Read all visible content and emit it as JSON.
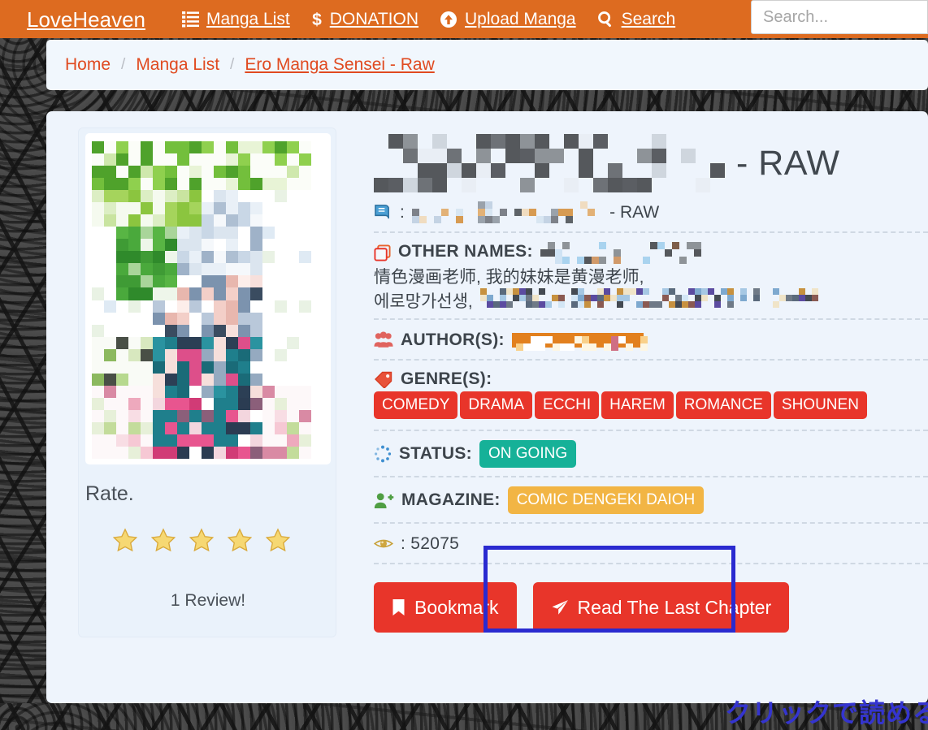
{
  "navbar": {
    "brand": "LoveHeaven",
    "accent_color": "#dd6b20",
    "links": [
      {
        "label": "Manga List",
        "icon": "list-icon"
      },
      {
        "label": "DONATION",
        "icon": "dollar-icon"
      },
      {
        "label": "Upload Manga",
        "icon": "upload-circle-icon"
      },
      {
        "label": "Search",
        "icon": "search-icon"
      }
    ],
    "search": {
      "placeholder": "Search...",
      "value": ""
    }
  },
  "breadcrumb": {
    "items": [
      {
        "label": "Home",
        "link": true
      },
      {
        "label": "Manga List",
        "link": true
      },
      {
        "label": "Ero Manga Sensei - Raw",
        "link": true
      }
    ],
    "separator": "/",
    "link_color": "#e04a20"
  },
  "manga": {
    "title_censored": true,
    "title_suffix": "- RAW",
    "cover_censored": true,
    "rate": {
      "label": "Rate.",
      "stars_total": 5,
      "stars_filled": 5,
      "review_text": "1 Review!"
    },
    "meta": {
      "alt_title": {
        "icon": "book-icon",
        "label": ":",
        "censored": true,
        "suffix": "- RAW"
      },
      "other_names": {
        "icon": "copy-icon",
        "label": "OTHER NAMES:",
        "visible_values": [
          "情色漫画老师, 我的妹妹是黄漫老师,",
          "에로망가선생,"
        ],
        "censored": true
      },
      "authors": {
        "icon": "users-icon",
        "label": "AUTHOR(S):",
        "censored": true
      },
      "genres": {
        "icon": "tag-icon",
        "label": "GENRE(S):",
        "values": [
          "COMEDY",
          "DRAMA",
          "ECCHI",
          "HAREM",
          "ROMANCE",
          "SHOUNEN"
        ],
        "badge_color": "#e8352a"
      },
      "status": {
        "icon": "spinner-icon",
        "label": "STATUS:",
        "value": "ON GOING",
        "badge_color": "#16b198"
      },
      "magazine": {
        "icon": "user-plus-icon",
        "label": "MAGAZINE:",
        "value": "COMIC DENGEKI DAIOH",
        "badge_color": "#f2b544"
      },
      "views": {
        "icon": "eye-icon",
        "label": ": 52075"
      }
    },
    "buttons": {
      "bookmark": {
        "label": "Bookmark",
        "icon": "bookmark-icon"
      },
      "read_last_chapter": {
        "label": "Read The Last Chapter",
        "icon": "paper-plane-icon"
      }
    }
  },
  "annotation": {
    "text": "クリックで読める",
    "color": "#3434cf",
    "highlight_color": "#2a2ad0"
  }
}
